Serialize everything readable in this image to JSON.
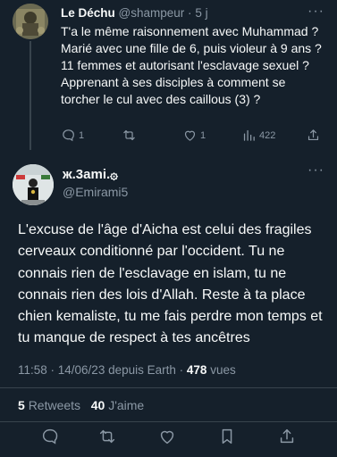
{
  "reply": {
    "name": "Le Déchu",
    "handle": "@shampeur",
    "sep": "·",
    "time": "5 j",
    "more": "···",
    "text": "T'a le même raisonnement avec Muhammad ? Marié avec une fille de 6, puis violeur à 9 ans ? 11 femmes et autorisant l'esclavage sexuel ? Apprenant à ses disciples à comment se torcher le cul avec des caillous (3) ?",
    "reply_count": "1",
    "like_count": "1",
    "view_count": "422"
  },
  "tweet": {
    "name": "ж.3ami.۞",
    "handle": "@Emirami5",
    "more": "···",
    "text": "L'excuse de l'âge d'Aicha est celui des fragiles cerveaux conditionné par l'occident. Tu ne connais rien de l'esclavage en islam, tu ne connais rien des lois d'Allah. Reste à ta place chien kemaliste, tu me fais perdre mon temps et tu manque de respect à tes ancêtres",
    "time": "11:58 · 14/06/23 depuis Earth ·",
    "views": "478",
    "views_label": "vues",
    "retweets": "5",
    "retweets_label": "Retweets",
    "likes": "40",
    "likes_label": "J'aime"
  },
  "colors": {
    "background": "#15202b",
    "text": "#f7f9f9",
    "muted": "#8b98a5",
    "divider": "#38444d"
  }
}
